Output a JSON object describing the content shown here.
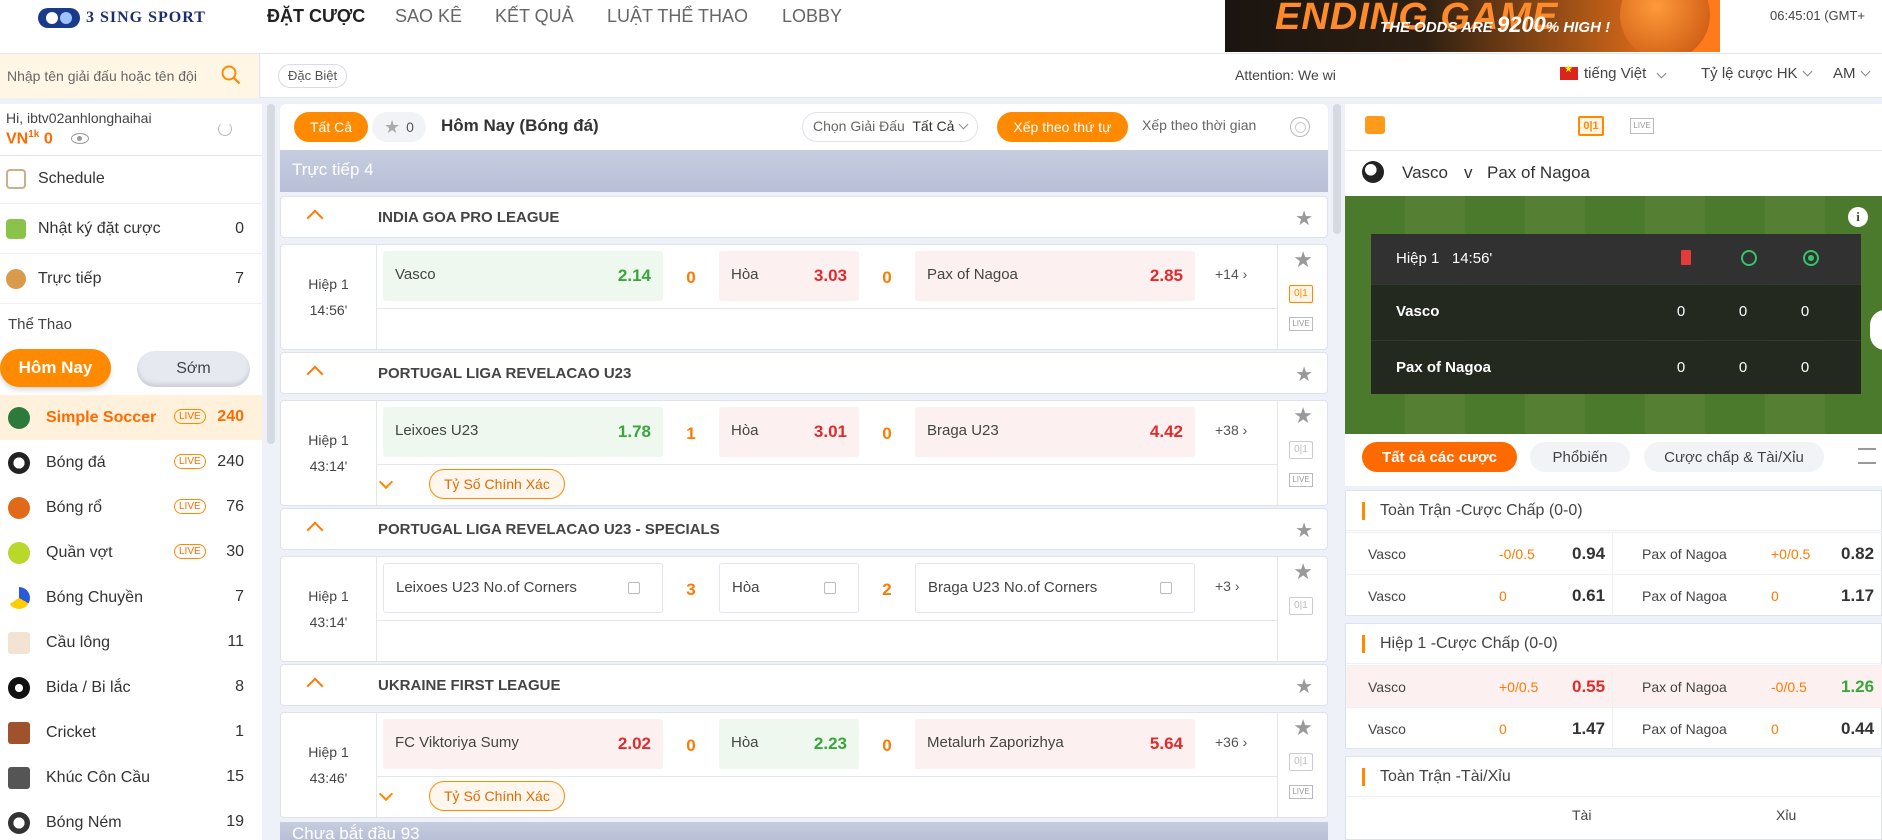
{
  "brand": {
    "logo_text": "3 SING SPORT"
  },
  "nav": [
    "ĐẶT CƯỢC",
    "SAO KÊ",
    "KẾT QUẢ",
    "LUẬT THỂ THAO",
    "LOBBY"
  ],
  "banner": {
    "title": "ENDING GAME",
    "tagline": "THE ODDS ARE",
    "percent": "9200",
    "suffix": "% HIGH !"
  },
  "clock": "06:45:01 (GMT+",
  "search": {
    "placeholder": "Nhập tên giải đấu hoặc tên đội"
  },
  "special_label": "Đặc Biệt",
  "attention": "Attention: We wi",
  "language": "tiếng Việt",
  "odds_type": "Tỷ lệ cược HK",
  "ampm": "AM",
  "account": {
    "greeting": "Hi, ibtv02anhlonghaihai",
    "currency": "VN",
    "currency_sup": "1k",
    "balance": "0"
  },
  "sidebar_links": [
    {
      "label": "Schedule",
      "count": ""
    },
    {
      "label": "Nhật ký đặt cược",
      "count": "0"
    },
    {
      "label": "Trực tiếp",
      "count": "7"
    }
  ],
  "section_label": "Thể Thao",
  "day_tabs": {
    "today": "Hôm Nay",
    "soon": "Sớm"
  },
  "sports": [
    {
      "label": "Simple Soccer",
      "live": "LIVE",
      "count": "240",
      "color": "#2d7a3d"
    },
    {
      "label": "Bóng đá",
      "live": "LIVE",
      "count": "240",
      "color": "#222222"
    },
    {
      "label": "Bóng rổ",
      "live": "LIVE",
      "count": "76",
      "color": "#e06a1a"
    },
    {
      "label": "Quần vợt",
      "live": "LIVE",
      "count": "30",
      "color": "#b8d82a"
    },
    {
      "label": "Bóng Chuyền",
      "live": "",
      "count": "7",
      "color": "#2a5ad8"
    },
    {
      "label": "Cầu lông",
      "live": "",
      "count": "11",
      "color": "#d84a2a"
    },
    {
      "label": "Bida / Bi lắc",
      "live": "",
      "count": "8",
      "color": "#111111"
    },
    {
      "label": "Cricket",
      "live": "",
      "count": "1",
      "color": "#a0522d"
    },
    {
      "label": "Khúc Côn Cầu",
      "live": "",
      "count": "15",
      "color": "#555555"
    },
    {
      "label": "Bóng Ném",
      "live": "",
      "count": "19",
      "color": "#333333"
    }
  ],
  "filter": {
    "all": "Tất Cả",
    "fav_count": "0",
    "title": "Hôm Nay (Bóng đá)",
    "league_label": "Chọn Giải Đấu",
    "league_value": "Tất Cả",
    "sort_order": "Xếp theo thứ tự",
    "sort_time": "Xếp theo thời gian"
  },
  "live_header": "Trực tiếp  4",
  "upcoming_header": "Chưa bắt đầu  93",
  "leagues": [
    {
      "name": "INDIA GOA PRO LEAGUE",
      "match": {
        "period": "Hiệp 1",
        "clock": "14:56'",
        "home": "Vasco",
        "home_odd": "2.14",
        "home_score": "0",
        "draw": "Hòa",
        "draw_odd": "3.03",
        "away_score": "0",
        "away": "Pax of Nagoa",
        "away_odd": "2.85",
        "more": "+14",
        "extra": ""
      }
    },
    {
      "name": "PORTUGAL LIGA REVELACAO U23",
      "match": {
        "period": "Hiệp 1",
        "clock": "43:14'",
        "home": "Leixoes U23",
        "home_odd": "1.78",
        "home_score": "1",
        "draw": "Hòa",
        "draw_odd": "3.01",
        "away_score": "0",
        "away": "Braga U23",
        "away_odd": "4.42",
        "more": "+38",
        "extra": "Tỷ Số Chính Xác"
      }
    },
    {
      "name": "PORTUGAL LIGA REVELACAO U23 - SPECIALS",
      "match": {
        "period": "Hiệp 1",
        "clock": "43:14'",
        "home": "Leixoes U23 No.of Corners",
        "home_odd": "",
        "home_score": "3",
        "draw": "Hòa",
        "draw_odd": "",
        "away_score": "2",
        "away": "Braga U23 No.of Corners",
        "away_odd": "",
        "more": "+3",
        "extra": ""
      }
    },
    {
      "name": "UKRAINE FIRST LEAGUE",
      "match": {
        "period": "Hiệp 1",
        "clock": "43:46'",
        "home": "FC Viktoriya Sumy",
        "home_odd": "2.02",
        "home_score": "0",
        "draw": "Hòa",
        "draw_odd": "2.23",
        "away_score": "0",
        "away": "Metalurh Zaporizhya",
        "away_odd": "5.64",
        "more": "+36",
        "extra": "Tỷ Số Chính Xác"
      }
    }
  ],
  "score_icon": "0|1",
  "live_icon": "LIVE",
  "right": {
    "home": "Vasco",
    "vs": "v",
    "away": "Pax of Nagoa",
    "scoreboard": {
      "period": "Hiệp 1",
      "clock": "14:56'",
      "rows": [
        {
          "team": "Vasco",
          "v1": "0",
          "v2": "0",
          "v3": "0"
        },
        {
          "team": "Pax of Nagoa",
          "v1": "0",
          "v2": "0",
          "v3": "0"
        }
      ]
    },
    "tabs": [
      "Tất cả các cược",
      "Phổbiến",
      "Cược chấp & Tài/Xỉu"
    ],
    "sections": [
      {
        "title": "Toàn Trận -Cược Chấp (0-0)",
        "rows": [
          {
            "home": "Vasco",
            "hcap": "-0/0.5",
            "hodd": "0.94",
            "away": "Pax of Nagoa",
            "acap": "+0/0.5",
            "aodd": "0.82"
          },
          {
            "home": "Vasco",
            "hcap": "0",
            "hodd": "0.61",
            "away": "Pax of Nagoa",
            "acap": "0",
            "aodd": "1.17"
          }
        ]
      },
      {
        "title": "Hiệp 1 -Cược Chấp (0-0)",
        "rows": [
          {
            "home": "Vasco",
            "hcap": "+0/0.5",
            "hodd": "0.55",
            "away": "Pax of Nagoa",
            "acap": "-0/0.5",
            "aodd": "1.26"
          },
          {
            "home": "Vasco",
            "hcap": "0",
            "hodd": "1.47",
            "away": "Pax of Nagoa",
            "acap": "0",
            "aodd": "0.44"
          }
        ]
      },
      {
        "title": "Toàn Trận -Tài/Xỉu",
        "rows": []
      }
    ],
    "col_tai": "Tài",
    "col_xiu": "Xỉu"
  }
}
